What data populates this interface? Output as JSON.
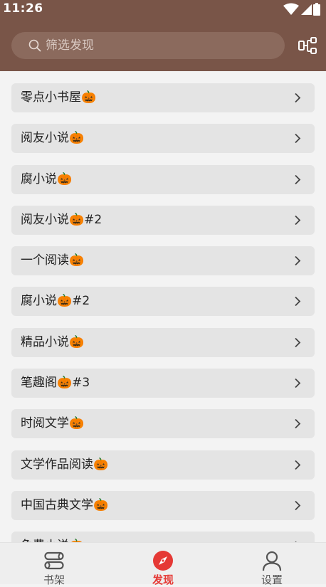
{
  "status_bar": {
    "time": "11:26",
    "icons": [
      "wifi-icon",
      "signal-icon",
      "battery-icon"
    ]
  },
  "search": {
    "placeholder": "筛选发现"
  },
  "icons": {
    "search": "search-icon",
    "tree": "tree-structure-icon",
    "chevron": "chevron-right-icon",
    "pumpkin": "jack-o-lantern-emoji"
  },
  "discover_list": [
    {
      "label": "零点小书屋🎃"
    },
    {
      "label": "阅友小说🎃"
    },
    {
      "label": "腐小说🎃"
    },
    {
      "label": "阅友小说🎃#2"
    },
    {
      "label": "一个阅读🎃"
    },
    {
      "label": "腐小说🎃#2"
    },
    {
      "label": "精品小说🎃"
    },
    {
      "label": "笔趣阁🎃#3"
    },
    {
      "label": "时阅文学🎃"
    },
    {
      "label": "文学作品阅读🎃"
    },
    {
      "label": "中国古典文学🎃"
    },
    {
      "label": "免费小说🎃"
    }
  ],
  "bottom_nav": {
    "items": [
      {
        "label": "书架",
        "icon": "bookshelf-icon",
        "active": false
      },
      {
        "label": "发现",
        "icon": "compass-icon",
        "active": true
      },
      {
        "label": "设置",
        "icon": "person-icon",
        "active": false
      }
    ]
  },
  "colors": {
    "toolbar": "#795548",
    "search_box": "#8b6a5d",
    "list_item": "#e4e4e4",
    "accent": "#e53935",
    "background": "#f3f3f3"
  }
}
